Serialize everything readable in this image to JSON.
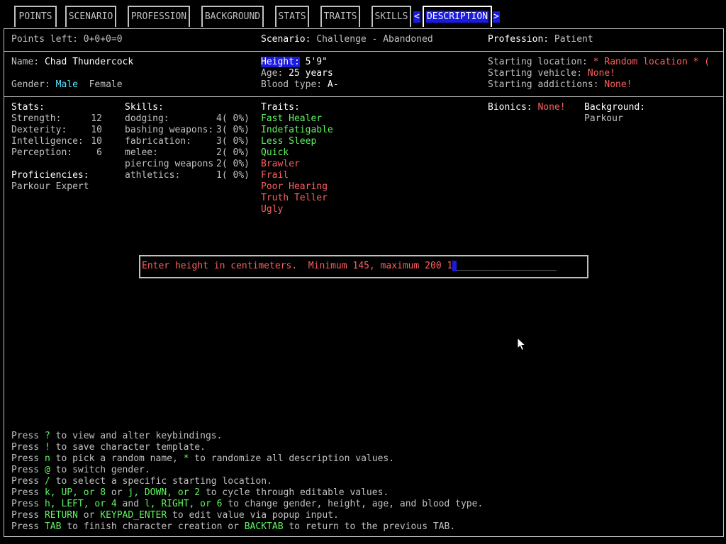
{
  "tabs": [
    {
      "label": "POINTS"
    },
    {
      "label": "SCENARIO"
    },
    {
      "label": "PROFESSION"
    },
    {
      "label": "BACKGROUND"
    },
    {
      "label": "STATS"
    },
    {
      "label": "TRAITS"
    },
    {
      "label": "SKILLS"
    },
    {
      "label": "DESCRIPTION",
      "active": true
    }
  ],
  "nav": {
    "prev": "<",
    "next": ">"
  },
  "header": {
    "points": "Points left: 0+0+0=0",
    "scenario_label": "Scenario:",
    "scenario_value": "Challenge - Abandoned",
    "profession_label": "Profession:",
    "profession_value": "Patient"
  },
  "description": {
    "name_label": "Name:",
    "name_value": "Chad Thundercock",
    "gender_label": "Gender:",
    "gender_male": "Male",
    "gender_female": "Female",
    "height_label": "Height:",
    "height_value": "5'9\"",
    "age_label": "Age:",
    "age_value": "25 years",
    "blood_label": "Blood type:",
    "blood_value": "A-",
    "location_label": "Starting location:",
    "location_value": "* Random location * (",
    "vehicle_label": "Starting vehicle:",
    "vehicle_value": "None!",
    "addictions_label": "Starting addictions:",
    "addictions_value": "None!"
  },
  "stats": {
    "title": "Stats:",
    "items": [
      {
        "name": "Strength:",
        "value": "12"
      },
      {
        "name": "Dexterity:",
        "value": "10"
      },
      {
        "name": "Intelligence:",
        "value": "10"
      },
      {
        "name": "Perception:",
        "value": "6"
      }
    ]
  },
  "proficiencies": {
    "title": "Proficiencies:",
    "items": [
      "Parkour Expert"
    ]
  },
  "skills": {
    "title": "Skills:",
    "items": [
      {
        "name": "dodging:",
        "value": "4( 0%)"
      },
      {
        "name": "bashing weapons:",
        "value": "3( 0%)"
      },
      {
        "name": "fabrication:",
        "value": "3( 0%)"
      },
      {
        "name": "melee:",
        "value": "2( 0%)"
      },
      {
        "name": "piercing weapons",
        "value": "2( 0%)"
      },
      {
        "name": "athletics:",
        "value": "1( 0%)"
      }
    ]
  },
  "traits": {
    "title": "Traits:",
    "items": [
      {
        "name": "Fast Healer",
        "color": "#5ff55f"
      },
      {
        "name": "Indefatigable",
        "color": "#5ff55f"
      },
      {
        "name": "Less Sleep",
        "color": "#5ff55f"
      },
      {
        "name": "Quick",
        "color": "#5ff55f"
      },
      {
        "name": "Brawler",
        "color": "#ff5f5f"
      },
      {
        "name": "Frail",
        "color": "#ff5f5f"
      },
      {
        "name": "Poor Hearing",
        "color": "#ff5f5f"
      },
      {
        "name": "Truth Teller",
        "color": "#ff5f5f"
      },
      {
        "name": "Ugly",
        "color": "#ff5f5f"
      }
    ]
  },
  "bionics": {
    "label": "Bionics:",
    "value": "None!"
  },
  "background": {
    "title": "Background:",
    "value": "Parkour"
  },
  "popup": {
    "prompt": "Enter height in centimeters.  Minimum 145, maximum 200",
    "input_value": "1",
    "input_fill": "__________________"
  },
  "help": [
    [
      {
        "t": "Press ",
        "c": "g"
      },
      {
        "t": "?",
        "c": "G"
      },
      {
        "t": " to view and alter keybindings.",
        "c": "g"
      }
    ],
    [
      {
        "t": "Press ",
        "c": "g"
      },
      {
        "t": "!",
        "c": "G"
      },
      {
        "t": " to save character template.",
        "c": "g"
      }
    ],
    [
      {
        "t": "Press ",
        "c": "g"
      },
      {
        "t": "n",
        "c": "G"
      },
      {
        "t": " to pick a random name, ",
        "c": "g"
      },
      {
        "t": "*",
        "c": "G"
      },
      {
        "t": " to randomize all description values.",
        "c": "g"
      }
    ],
    [
      {
        "t": "Press ",
        "c": "g"
      },
      {
        "t": "@",
        "c": "G"
      },
      {
        "t": " to switch gender.",
        "c": "g"
      }
    ],
    [
      {
        "t": "Press ",
        "c": "g"
      },
      {
        "t": "/",
        "c": "G"
      },
      {
        "t": " to select a specific starting location.",
        "c": "g"
      }
    ],
    [
      {
        "t": "Press ",
        "c": "g"
      },
      {
        "t": "k, UP, or 8",
        "c": "G"
      },
      {
        "t": " or ",
        "c": "g"
      },
      {
        "t": "j, DOWN, or 2",
        "c": "G"
      },
      {
        "t": " to cycle through editable values.",
        "c": "g"
      }
    ],
    [
      {
        "t": "Press ",
        "c": "g"
      },
      {
        "t": "h, LEFT, or 4",
        "c": "G"
      },
      {
        "t": " and ",
        "c": "g"
      },
      {
        "t": "l, RIGHT, or 6",
        "c": "G"
      },
      {
        "t": " to change gender, height, age, and blood type.",
        "c": "g"
      }
    ],
    [
      {
        "t": "Press ",
        "c": "g"
      },
      {
        "t": "RETURN",
        "c": "G"
      },
      {
        "t": " or ",
        "c": "g"
      },
      {
        "t": "KEYPAD_ENTER",
        "c": "G"
      },
      {
        "t": " to edit value via popup input.",
        "c": "g"
      }
    ],
    [
      {
        "t": "Press ",
        "c": "g"
      },
      {
        "t": "TAB",
        "c": "G"
      },
      {
        "t": " to finish character creation or ",
        "c": "g"
      },
      {
        "t": "BACKTAB",
        "c": "G"
      },
      {
        "t": " to return to the previous TAB.",
        "c": "g"
      }
    ]
  ]
}
